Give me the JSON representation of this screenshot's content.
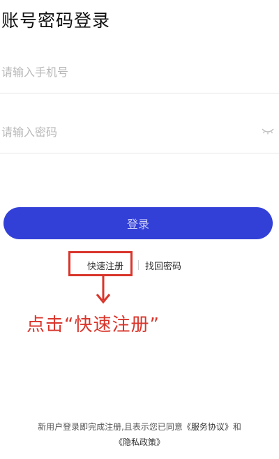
{
  "page": {
    "title": "账号密码登录"
  },
  "form": {
    "phone_placeholder": "请输入手机号",
    "password_placeholder": "请输入密码",
    "password_toggle_icon": "eye-closed-icon",
    "login_label": "登录"
  },
  "links": {
    "register": "快速注册",
    "divider": "|",
    "forgot": "找回密码"
  },
  "annotation": {
    "text": "点击“快速注册”",
    "color": "#d9352b"
  },
  "agreement": {
    "prefix": "新用户登录即完成注册,且表示您已同意",
    "service": "《服务协议》",
    "and": "和",
    "privacy": "《隐私政策》"
  },
  "colors": {
    "accent": "#3340d8",
    "annotation": "#d9352b"
  }
}
